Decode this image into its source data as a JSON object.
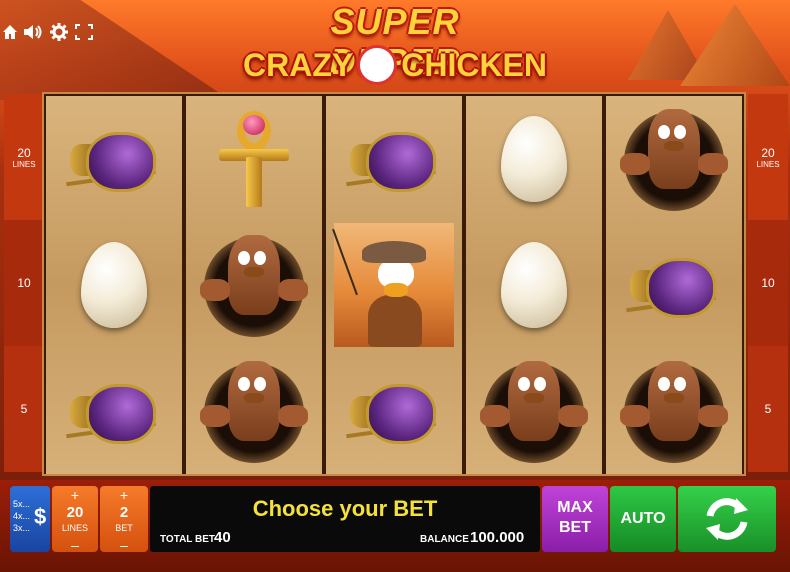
{
  "game": {
    "logo_line1": "SUPER DUPER",
    "logo_line2_a": "CRAZY",
    "logo_line2_b": "CHICKEN"
  },
  "top_controls": [
    {
      "name": "home-icon",
      "glyph": "⌂"
    },
    {
      "name": "sound-icon",
      "glyph": "🔊"
    },
    {
      "name": "gear-icon",
      "glyph": "⚙"
    },
    {
      "name": "fullscreen-icon",
      "glyph": "⛶"
    }
  ],
  "lines_indicator": {
    "left": [
      {
        "value": "20",
        "label": "LINES"
      },
      {
        "value": "10",
        "label": ""
      },
      {
        "value": "5",
        "label": ""
      }
    ],
    "right": [
      {
        "value": "20",
        "label": "LINES"
      },
      {
        "value": "10",
        "label": ""
      },
      {
        "value": "5",
        "label": ""
      }
    ]
  },
  "reels": [
    [
      "scarab",
      "egg",
      "scarab"
    ],
    [
      "ankh",
      "chicken-hole",
      "chicken-hole"
    ],
    [
      "scarab",
      "wild-chicken",
      "scarab"
    ],
    [
      "egg",
      "egg",
      "chicken-hole"
    ],
    [
      "chicken-hole",
      "scarab",
      "chicken-hole"
    ]
  ],
  "controls": {
    "denom_options": [
      "5x...",
      "4x...",
      "3x..."
    ],
    "denom_symbol": "$",
    "lines_value": "20",
    "lines_label": "LINES",
    "bet_value": "2",
    "bet_label": "BET",
    "plus": "+",
    "minus": "–",
    "message": "Choose your BET",
    "total_bet_label": "TOTAL BET",
    "total_bet_value": "40",
    "balance_label": "BALANCE",
    "balance_value": "100.000",
    "max_bet_line1": "MAX",
    "max_bet_line2": "BET",
    "auto_label": "AUTO"
  },
  "colors": {
    "background": "#a8300e",
    "message_text": "#f4e13a",
    "max_bet": "#b036cc",
    "auto": "#22b436",
    "spin": "#26b83a",
    "lines_bet": "#ee6a1e",
    "denom": "#2558c0"
  }
}
